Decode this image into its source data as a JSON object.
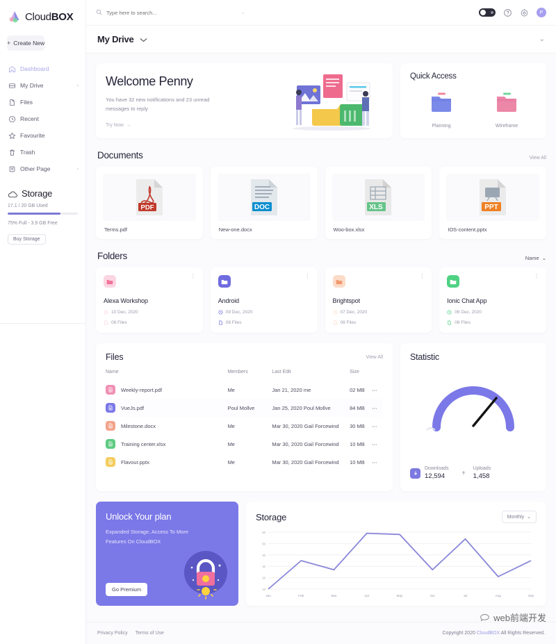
{
  "brand": {
    "name_light": "Cloud",
    "name_bold": "BOX"
  },
  "sidebar": {
    "create_new_label": "Create New",
    "items": [
      {
        "label": "Dashboard",
        "icon": "home-icon",
        "chevron": "",
        "active": true
      },
      {
        "label": "My Drive",
        "icon": "drive-icon",
        "chevron": "›",
        "active": false
      },
      {
        "label": "Files",
        "icon": "file-icon",
        "chevron": "",
        "active": false
      },
      {
        "label": "Recent",
        "icon": "clock-icon",
        "chevron": "",
        "active": false
      },
      {
        "label": "Favourite",
        "icon": "star-icon",
        "chevron": "",
        "active": false
      },
      {
        "label": "Trash",
        "icon": "trash-icon",
        "chevron": "",
        "active": false
      },
      {
        "label": "Other Page",
        "icon": "page-icon",
        "chevron": "›",
        "active": false
      }
    ],
    "storage": {
      "title": "Storage",
      "used_text": "17.1 / 20 GB Used",
      "free_text": "75% Full - 3.9 GB Free",
      "percent": 75,
      "buy_label": "Buy Storage",
      "bar_color": "#7b79d4"
    }
  },
  "topbar": {
    "search_placeholder": "Type here to search...",
    "toggle_state": "on",
    "help_icon": "help-circle-icon",
    "settings_icon": "settings-icon",
    "avatar_initial": "P"
  },
  "drive_bar": {
    "title": "My Drive"
  },
  "welcome": {
    "heading": "Welcome Penny",
    "subtext": "You have 32 new notifications and 23 unread messages to reply",
    "cta": "Try Now"
  },
  "quick_access": {
    "title": "Quick Access",
    "items": [
      {
        "label": "Planning",
        "color": "#7b8ae8",
        "tab_color": "#f0879c"
      },
      {
        "label": "Wireframe",
        "color": "#ec87a8",
        "tab_color": "#6fd79b"
      }
    ]
  },
  "documents": {
    "title": "Documents",
    "view_all": "View All",
    "items": [
      {
        "name": "Terms.pdf",
        "kind": "PDF",
        "color": "#c0392b"
      },
      {
        "name": "New-one.docx",
        "kind": "DOC",
        "color": "#0a8ecf"
      },
      {
        "name": "Woo-box.xlsx",
        "kind": "XLS",
        "color": "#66c48a"
      },
      {
        "name": "IOS-content.pptx",
        "kind": "PPT",
        "color": "#ef8024"
      }
    ]
  },
  "folders": {
    "title": "Folders",
    "sort_label": "Name",
    "items": [
      {
        "name": "Alexa Workshop",
        "date": "10 Dec, 2020",
        "files": "08 Files",
        "color": "#f2739a",
        "bg": "#fbd5e2"
      },
      {
        "name": "Android",
        "date": "09 Dec, 2020",
        "files": "08 Files",
        "color": "#ffffff",
        "bg": "#6f6ce0"
      },
      {
        "name": "Brightspot",
        "date": "07 Dec, 2020",
        "files": "08 Files",
        "color": "#f09a6e",
        "bg": "#fcdcc8"
      },
      {
        "name": "Ionic Chat App",
        "date": "06 Dec, 2020",
        "files": "08 Files",
        "color": "#ffffff",
        "bg": "#4fd283"
      }
    ]
  },
  "files": {
    "title": "Files",
    "view_all": "View All",
    "columns": [
      "Name",
      "Members",
      "Last Edit",
      "Size"
    ],
    "rows": [
      {
        "name": "Weekly-report.pdf",
        "members": "Me",
        "last_edit": "Jan 21, 2020 me",
        "size": "02 MB",
        "color": "#f090b4",
        "highlight": false
      },
      {
        "name": "VueJs.pdf",
        "members": "Poul Mollve",
        "last_edit": "Jan 25, 2020 Poul Mollve",
        "size": "84 MB",
        "color": "#7b78e8",
        "highlight": true
      },
      {
        "name": "Milestone.docx",
        "members": "Me",
        "last_edit": "Mar 30, 2020 Gail Forcewind",
        "size": "30 MB",
        "color": "#f2a48c",
        "highlight": false
      },
      {
        "name": "Training center.xlsx",
        "members": "Me",
        "last_edit": "Mar 30, 2020 Gail Forcewind",
        "size": "10 MB",
        "color": "#5ecb82",
        "highlight": false
      },
      {
        "name": "Flavour.pptx",
        "members": "Me",
        "last_edit": "Mar 30, 2020 Gail Forcewind",
        "size": "10 MB",
        "color": "#f3cc5c",
        "highlight": false
      }
    ],
    "row_menu": "⋯"
  },
  "statistic": {
    "title": "Statistic",
    "downloads_label": "Downloads",
    "downloads_value": "12,594",
    "uploads_label": "Uploads",
    "uploads_value": "1,458",
    "gauge_percent": 72,
    "gauge_color": "#7b78e8"
  },
  "promo": {
    "title": "Unlock Your plan",
    "subtitle": "Expanded Storage, Access To More Features On CloudBOX",
    "button": "Go Premium",
    "bg_color": "#7b78e8"
  },
  "footer": {
    "privacy": "Privacy Policy",
    "terms": "Terms of Use",
    "copyright_prefix": "Copyright 2020",
    "copyright_brand": "CloudBOX",
    "copyright_suffix": "All Rights Reserved.",
    "watermark": "web前端开发"
  },
  "chart_data": {
    "type": "line",
    "title": "Storage",
    "period_label": "Monthly",
    "x": [
      "Jan",
      "Feb",
      "Mar",
      "Apr",
      "May",
      "Jun",
      "Jul",
      "Aug",
      "Sep"
    ],
    "values": [
      10,
      35,
      27,
      59,
      58,
      27,
      54,
      21,
      35
    ],
    "ylim": [
      10,
      60
    ],
    "yticks": [
      10,
      20,
      30,
      40,
      50,
      60
    ],
    "xlabel": "",
    "ylabel": "",
    "grid": true,
    "line_color": "#8986d8",
    "legend": "none"
  }
}
